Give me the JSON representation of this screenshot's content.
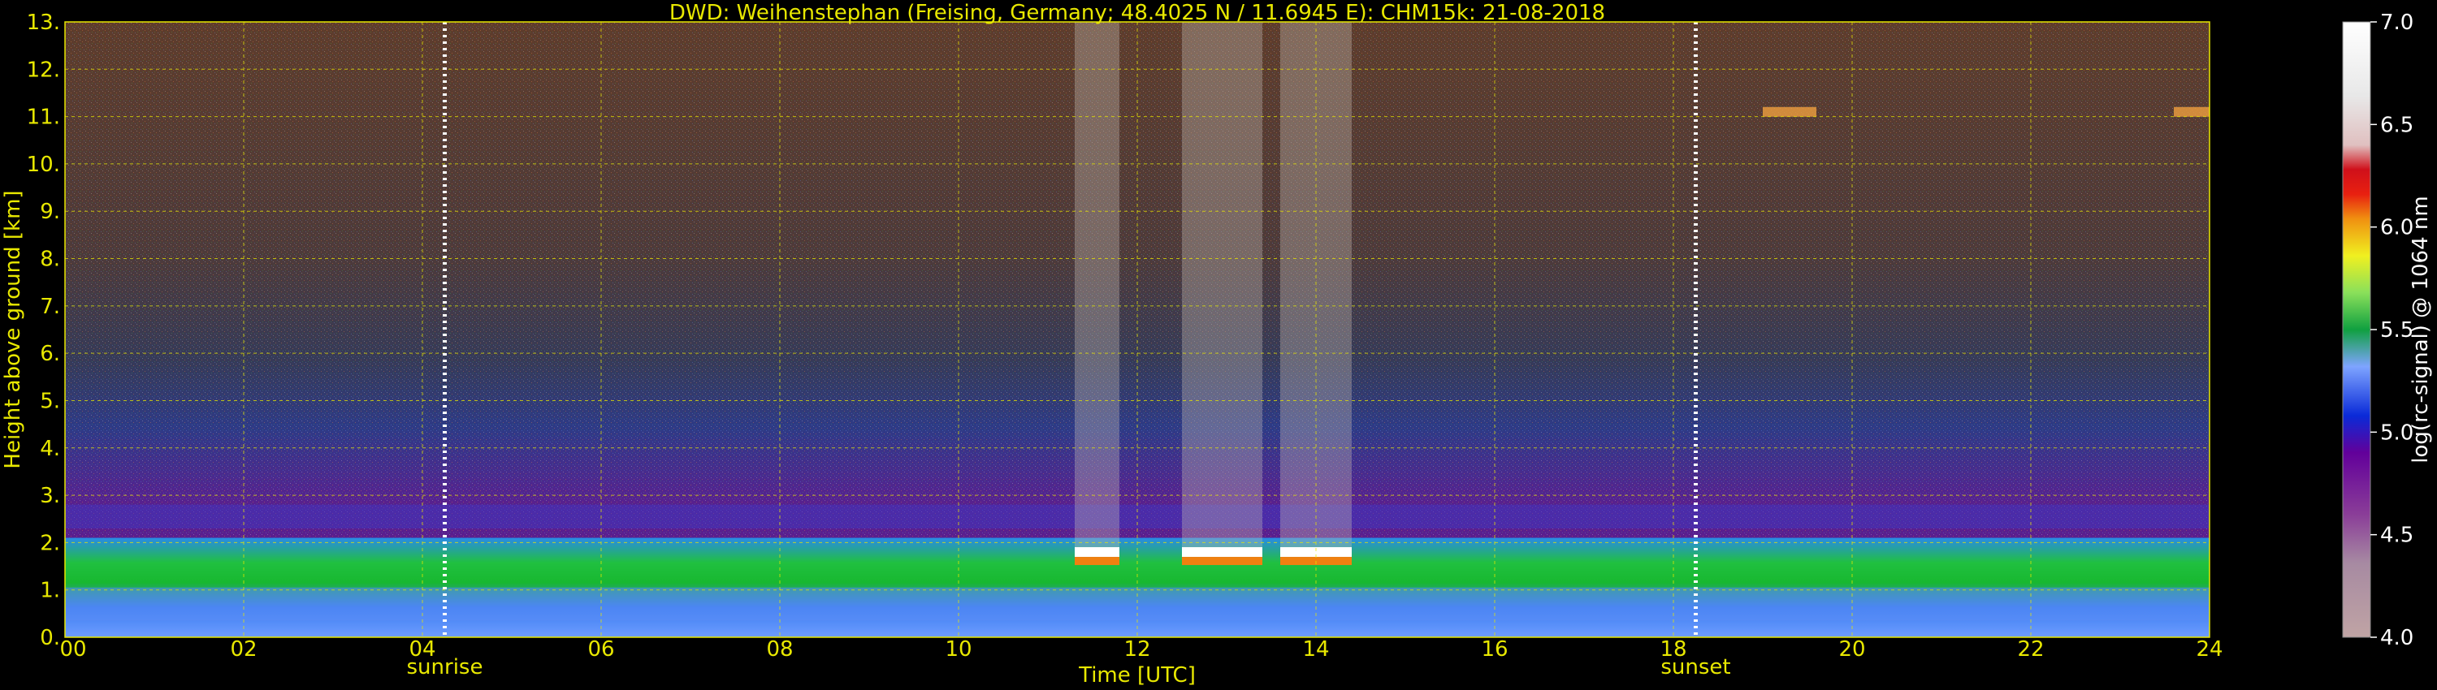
{
  "chart_data": {
    "type": "heatmap",
    "title": "DWD: Weihenstephan (Freising, Germany; 48.4025 N / 11.6945 E):    CHM15k: 21-08-2018",
    "xlabel": "Time [UTC]",
    "ylabel": "Height above ground [km]",
    "xlim": [
      0,
      24
    ],
    "ylim": [
      0,
      13
    ],
    "x_ticks": [
      "00",
      "02",
      "04",
      "06",
      "08",
      "10",
      "12",
      "14",
      "16",
      "18",
      "20",
      "22",
      "24"
    ],
    "y_ticks": [
      "0.",
      "1.",
      "2.",
      "3.",
      "4.",
      "5.",
      "6.",
      "7.",
      "8.",
      "9.",
      "10.",
      "11.",
      "12.",
      "13."
    ],
    "grid": true,
    "annotations": [
      {
        "label": "sunrise",
        "x": 4.25
      },
      {
        "label": "sunset",
        "x": 18.25
      }
    ],
    "colorbar": {
      "label": "log(rc-signal) @ 1064 nm",
      "range": [
        4.0,
        7.0
      ],
      "ticks": [
        "4.0",
        "4.5",
        "5.0",
        "5.5",
        "6.0",
        "6.5",
        "7.0"
      ]
    },
    "features": {
      "boundary_layer_top_km": 2.1,
      "cloud_base_km": 1.8,
      "cloud_periods_utc": [
        [
          11.3,
          11.8
        ],
        [
          12.5,
          13.4
        ],
        [
          13.6,
          14.4
        ]
      ],
      "high_cloud_km": 11.1
    }
  },
  "colors": {
    "text_yellow": "#e8e800",
    "colorbar_text": "#ffffff",
    "background": "#000000"
  }
}
